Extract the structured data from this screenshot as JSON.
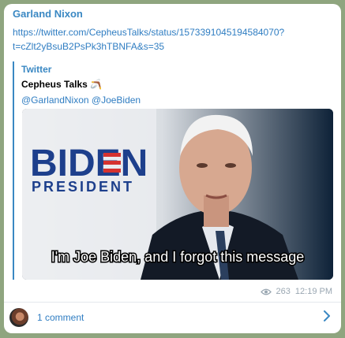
{
  "message": {
    "sender": "Garland Nixon",
    "link_line1": "https://twitter.com/CepheusTalks/status/1573391045194584070?",
    "link_line2": "t=cZlt2yBsuB2PsPk3hTBNFA&s=35"
  },
  "preview": {
    "site": "Twitter",
    "title": "Cepheus Talks 🪃",
    "description": "@GarlandNixon @JoeBiden",
    "image": {
      "logo_text": "BIDEN",
      "logo_subtext": "PRESIDENT",
      "caption": "I'm Joe Biden, and I forgot this message"
    }
  },
  "meta": {
    "views": "263",
    "time": "12:19 PM"
  },
  "footer": {
    "comments_label": "1 comment"
  },
  "colors": {
    "accent": "#3a88c3",
    "link": "#2f7dc2",
    "background": "#8fa57f"
  },
  "icons": {
    "views": "eye-icon",
    "open": "chevron-right-icon"
  }
}
